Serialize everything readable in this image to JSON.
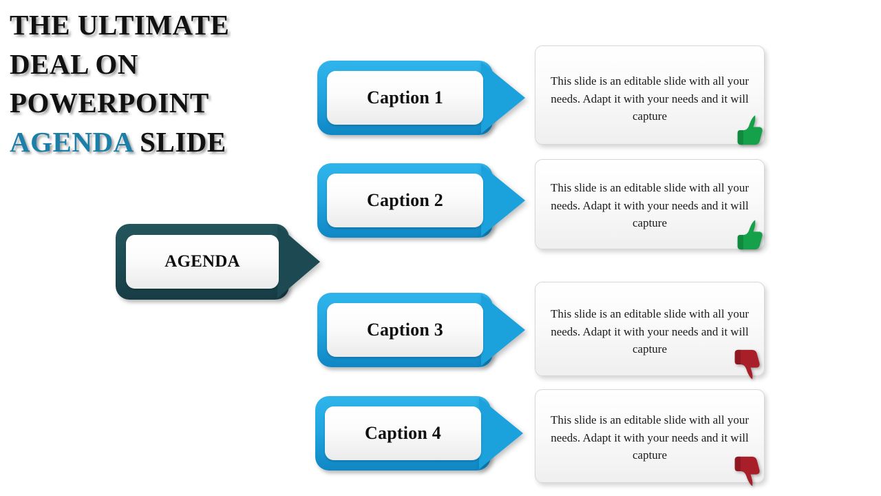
{
  "slide": {
    "background": "#ffffff",
    "title": {
      "lines": [
        {
          "text": "THE ULTIMATE",
          "accent": false
        },
        {
          "text": "DEAL ON",
          "accent": false
        },
        {
          "text": "POWERPOINT",
          "accent": false
        }
      ],
      "last_line": {
        "accent_text": "AGENDA",
        "plain_text": " SLIDE"
      },
      "color": "#111111",
      "accent_color": "#1b7fa8"
    },
    "hub": {
      "label": "AGENDA",
      "color": "#1d4a52"
    },
    "colors": {
      "caption_blue": "#1ba2dd",
      "hub_teal": "#1d4a52",
      "thumb_up_green": "#15a04a",
      "thumb_down_red": "#a81f2a",
      "panel_border": "#d7d7d7"
    },
    "rows": [
      {
        "caption": "Caption 1",
        "body": "This slide is an editable slide with all your needs. Adapt it with your needs and it will capture",
        "icon": "thumbs-up-icon",
        "icon_color": "#15a04a"
      },
      {
        "caption": "Caption 2",
        "body": "This slide is an editable slide with all your needs. Adapt it with your needs and it will capture",
        "icon": "thumbs-up-icon",
        "icon_color": "#15a04a"
      },
      {
        "caption": "Caption 3",
        "body": "This slide is an editable slide with all your needs. Adapt it with your needs and it will capture",
        "icon": "thumbs-down-icon",
        "icon_color": "#a81f2a"
      },
      {
        "caption": "Caption 4",
        "body": "This slide is an editable slide with all your needs. Adapt it with your needs and it will capture",
        "icon": "thumbs-down-icon",
        "icon_color": "#a81f2a"
      }
    ]
  }
}
